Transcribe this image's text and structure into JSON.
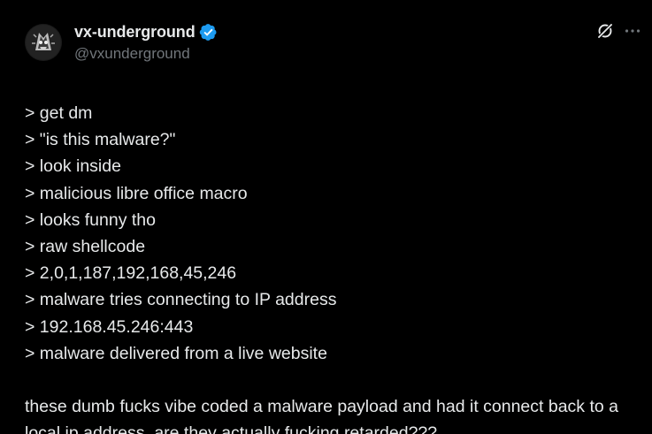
{
  "author": {
    "display_name": "vx-underground",
    "handle": "@vxunderground",
    "verified": true,
    "verified_color": "#1d9bf0"
  },
  "actions": {
    "grok_icon": "grok-icon",
    "more_icon": "more-icon"
  },
  "post": {
    "lines": [
      "> get dm",
      "> \"is this malware?\"",
      "> look inside",
      "> malicious libre office macro",
      "> looks funny tho",
      "> raw shellcode",
      "> 2,0,1,187,192,168,45,246",
      "> malware tries connecting to IP address",
      "> 192.168.45.246:443",
      "> malware delivered from a live website"
    ],
    "closing": "these dumb fucks vibe coded a malware payload and had it connect back to a local ip address. are they actually fucking retarded???"
  }
}
